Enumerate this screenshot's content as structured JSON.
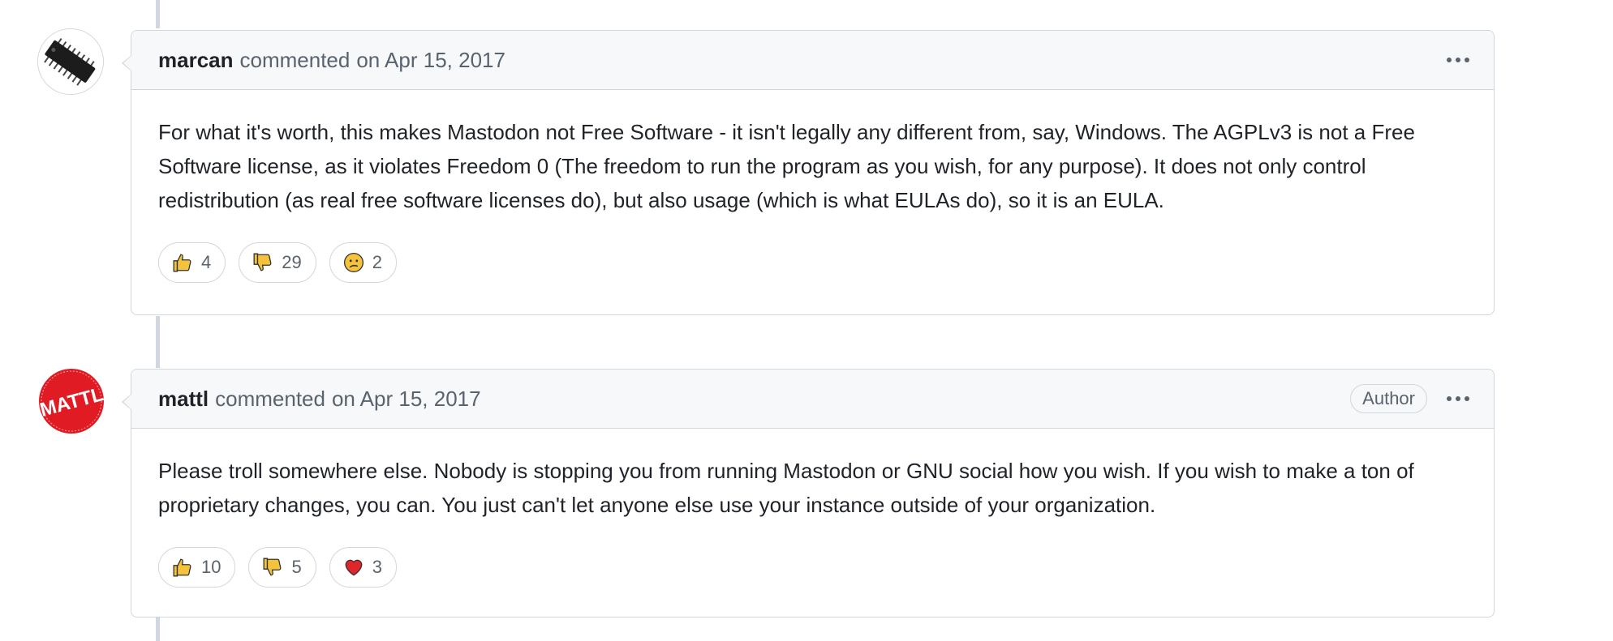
{
  "comments": [
    {
      "author": "marcan",
      "action": "commented",
      "timestamp": "on Apr 15, 2017",
      "avatar_icon": "ic-chip-icon",
      "body": "For what it's worth, this makes Mastodon not Free Software - it isn't legally any different from, say, Windows. The AGPLv3 is not a Free Software license, as it violates Freedom 0 (The freedom to run the program as you wish, for any purpose). It does not only control redistribution (as real free software licenses do), but also usage (which is what EULAs do), so it is an EULA.",
      "reactions": [
        {
          "icon": "thumbs-up-icon",
          "count": "4"
        },
        {
          "icon": "thumbs-down-icon",
          "count": "29"
        },
        {
          "icon": "confused-face-icon",
          "count": "2"
        }
      ]
    },
    {
      "author": "mattl",
      "action": "commented",
      "timestamp": "on Apr 15, 2017",
      "badge": "Author",
      "avatar_text": "MATTL",
      "body": "Please troll somewhere else. Nobody is stopping you from running Mastodon or GNU social how you wish. If you wish to make a ton of proprietary changes, you can. You just can't let anyone else use your instance outside of your organization.",
      "reactions": [
        {
          "icon": "thumbs-up-icon",
          "count": "10"
        },
        {
          "icon": "thumbs-down-icon",
          "count": "5"
        },
        {
          "icon": "heart-icon",
          "count": "3"
        }
      ]
    }
  ],
  "colors": {
    "border": "#d0d7de",
    "header_bg": "#f6f8fa",
    "muted_text": "#59636e",
    "emoji_yellow": "#f5c33b",
    "heart_red": "#e0262b",
    "mattl_avatar_red": "#e01b24"
  }
}
